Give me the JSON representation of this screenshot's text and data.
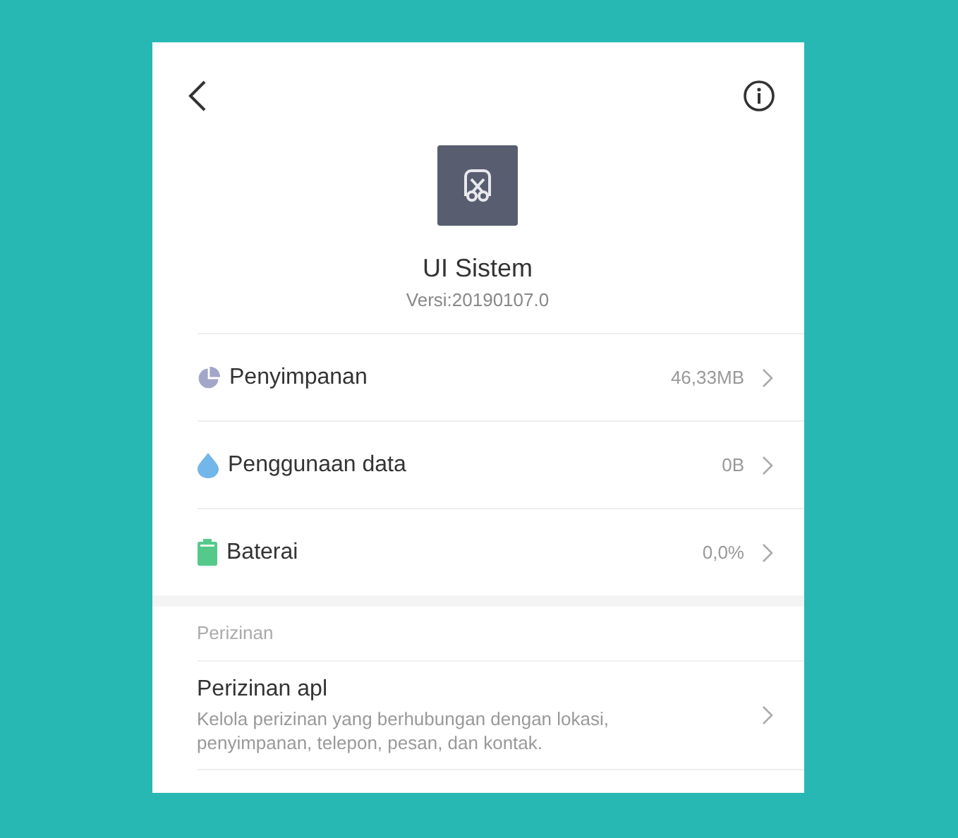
{
  "app": {
    "name": "UI Sistem",
    "version": "Versi:20190107.0"
  },
  "items": [
    {
      "kind": "storage",
      "label": "Penyimpanan",
      "value": "46,33MB"
    },
    {
      "kind": "data",
      "label": "Penggunaan data",
      "value": "0B"
    },
    {
      "kind": "battery",
      "label": "Baterai",
      "value": "0,0%"
    }
  ],
  "section": {
    "title": "Perizinan",
    "items": [
      {
        "label": "Perizinan apl",
        "description": "Kelola perizinan yang berhubungan dengan lokasi, penyimpanan, telepon, pesan, dan kontak."
      }
    ]
  }
}
